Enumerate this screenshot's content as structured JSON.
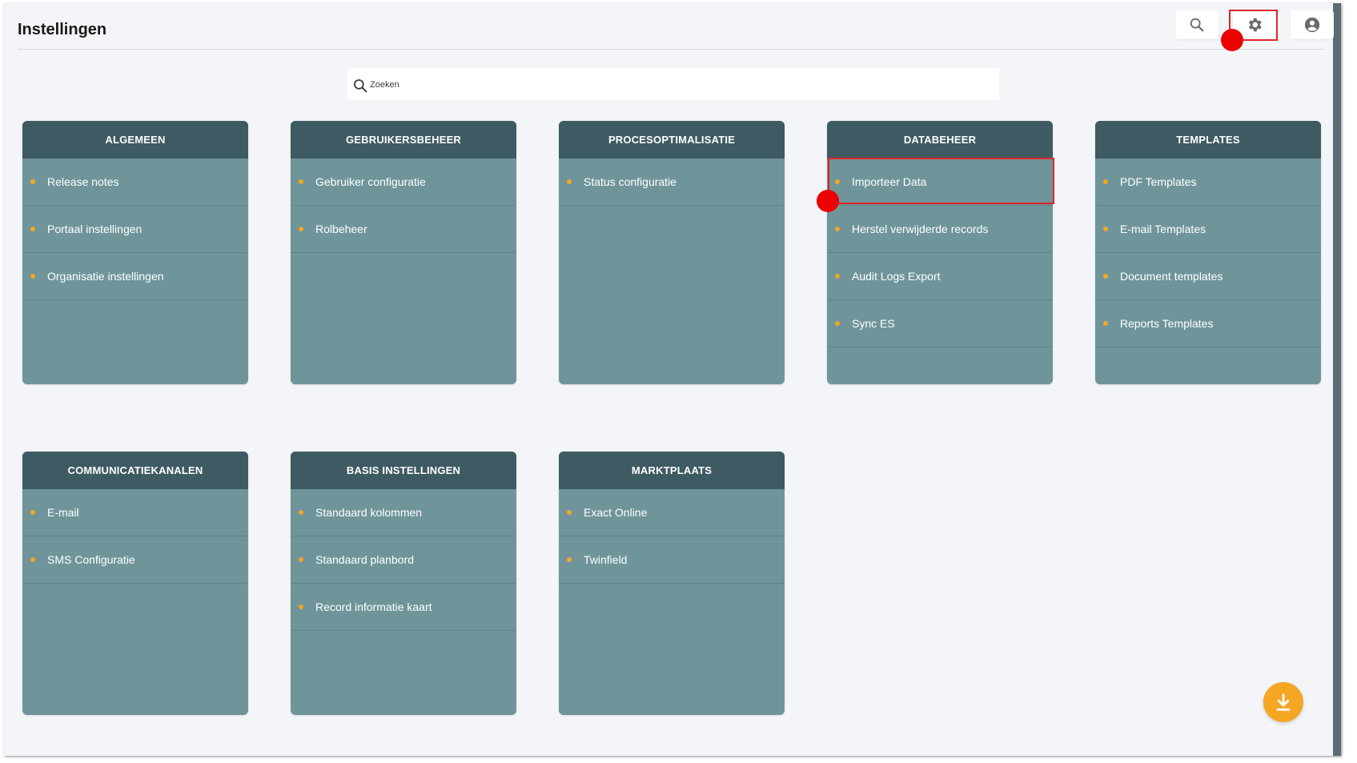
{
  "page": {
    "title": "Instellingen"
  },
  "toolbar": {
    "search_icon": "search-icon",
    "settings_icon": "gear-icon",
    "account_icon": "account-circle-icon"
  },
  "search": {
    "placeholder": "Zoeken"
  },
  "cards": [
    {
      "title": "ALGEMEEN",
      "items": [
        "Release notes",
        "Portaal instellingen",
        "Organisatie instellingen"
      ]
    },
    {
      "title": "GEBRUIKERSBEHEER",
      "items": [
        "Gebruiker configuratie",
        "Rolbeheer"
      ]
    },
    {
      "title": "PROCESOPTIMALISATIE",
      "items": [
        "Status configuratie"
      ]
    },
    {
      "title": "DATABEHEER",
      "items": [
        "Importeer Data",
        "Herstel verwijderde records",
        "Audit Logs Export",
        "Sync ES"
      ]
    },
    {
      "title": "TEMPLATES",
      "items": [
        "PDF Templates",
        "E-mail Templates",
        "Document templates",
        "Reports Templates"
      ]
    },
    {
      "title": "COMMUNICATIEKANALEN",
      "items": [
        "E-mail",
        "SMS Configuratie"
      ]
    },
    {
      "title": "BASIS INSTELLINGEN",
      "items": [
        "Standaard kolommen",
        "Standaard planbord",
        "Record informatie kaart"
      ]
    },
    {
      "title": "MARKTPLAATS",
      "items": [
        "Exact Online",
        "Twinfield"
      ]
    }
  ],
  "fab": {
    "icon": "download-icon"
  },
  "colors": {
    "card_header": "#3e5b63",
    "card_body": "#6f959b",
    "bullet": "#f5a623",
    "fab": "#f5a623",
    "highlight": "#e0262a"
  }
}
